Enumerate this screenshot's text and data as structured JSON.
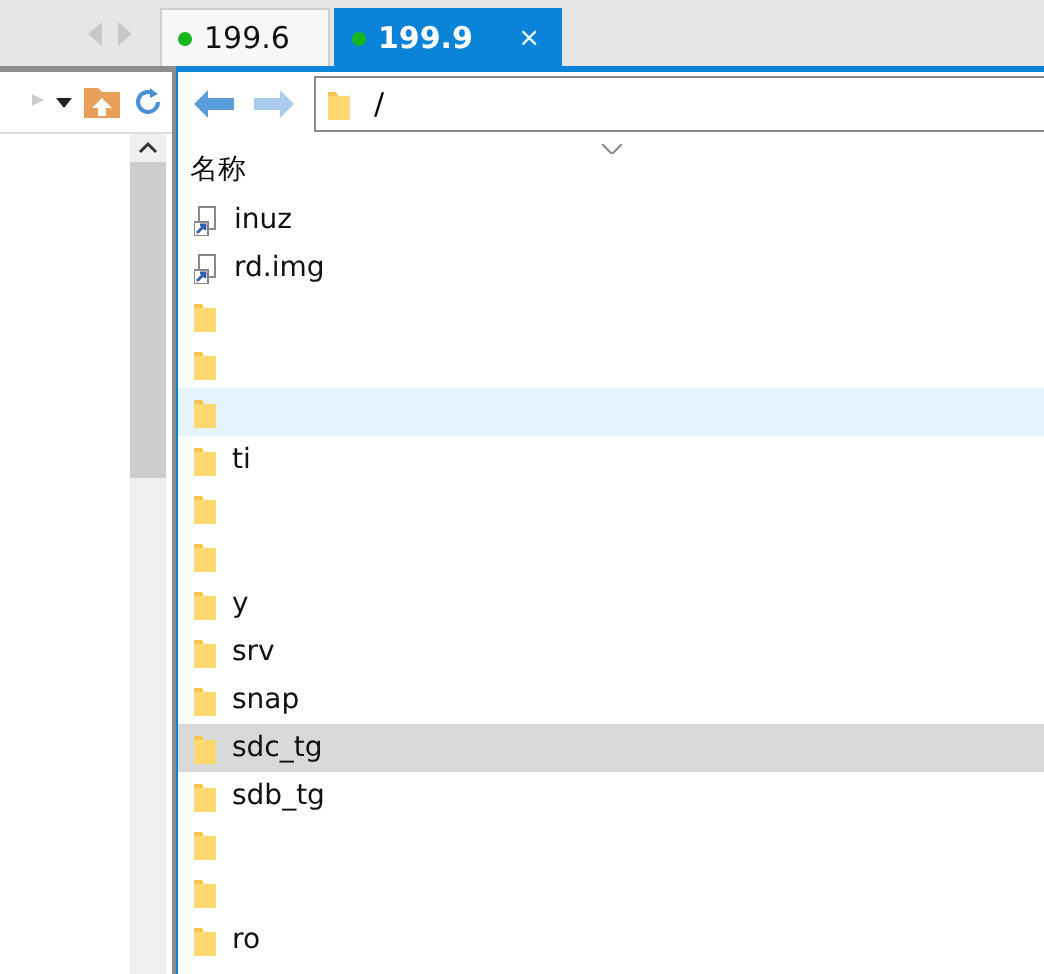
{
  "tabs": [
    {
      "label": "199.6",
      "selected": false
    },
    {
      "label": "199.9",
      "selected": true,
      "close": "×"
    }
  ],
  "address": {
    "path": "/"
  },
  "columns": [
    "名称"
  ],
  "files": [
    {
      "kind": "link",
      "name": "inuz",
      "selected": false,
      "hovered": false
    },
    {
      "kind": "link",
      "name": "rd.img",
      "selected": false,
      "hovered": false
    },
    {
      "kind": "folder",
      "selected": false,
      "hovered": false
    },
    {
      "kind": "folder",
      "selected": false,
      "hovered": false
    },
    {
      "kind": "folder",
      "selected": false,
      "hovered": true
    },
    {
      "kind": "folder",
      "name": "ti",
      "selected": false,
      "hovered": false
    },
    {
      "kind": "folder",
      "selected": false,
      "hovered": false
    },
    {
      "kind": "folder",
      "selected": false,
      "hovered": false
    },
    {
      "kind": "folder",
      "name": "y",
      "selected": false,
      "hovered": false
    },
    {
      "kind": "folder",
      "name": "srv",
      "selected": false,
      "hovered": false
    },
    {
      "kind": "folder",
      "name": "snap",
      "selected": false,
      "hovered": false
    },
    {
      "kind": "folder",
      "name": "sdc_tg",
      "selected": true,
      "hovered": false
    },
    {
      "kind": "folder",
      "name": "sdb_tg",
      "selected": false,
      "hovered": false
    },
    {
      "kind": "folder",
      "selected": false,
      "hovered": false
    },
    {
      "kind": "folder",
      "selected": false,
      "hovered": false
    },
    {
      "kind": "folder",
      "name": "ro",
      "selected": false,
      "hovered": false
    }
  ]
}
